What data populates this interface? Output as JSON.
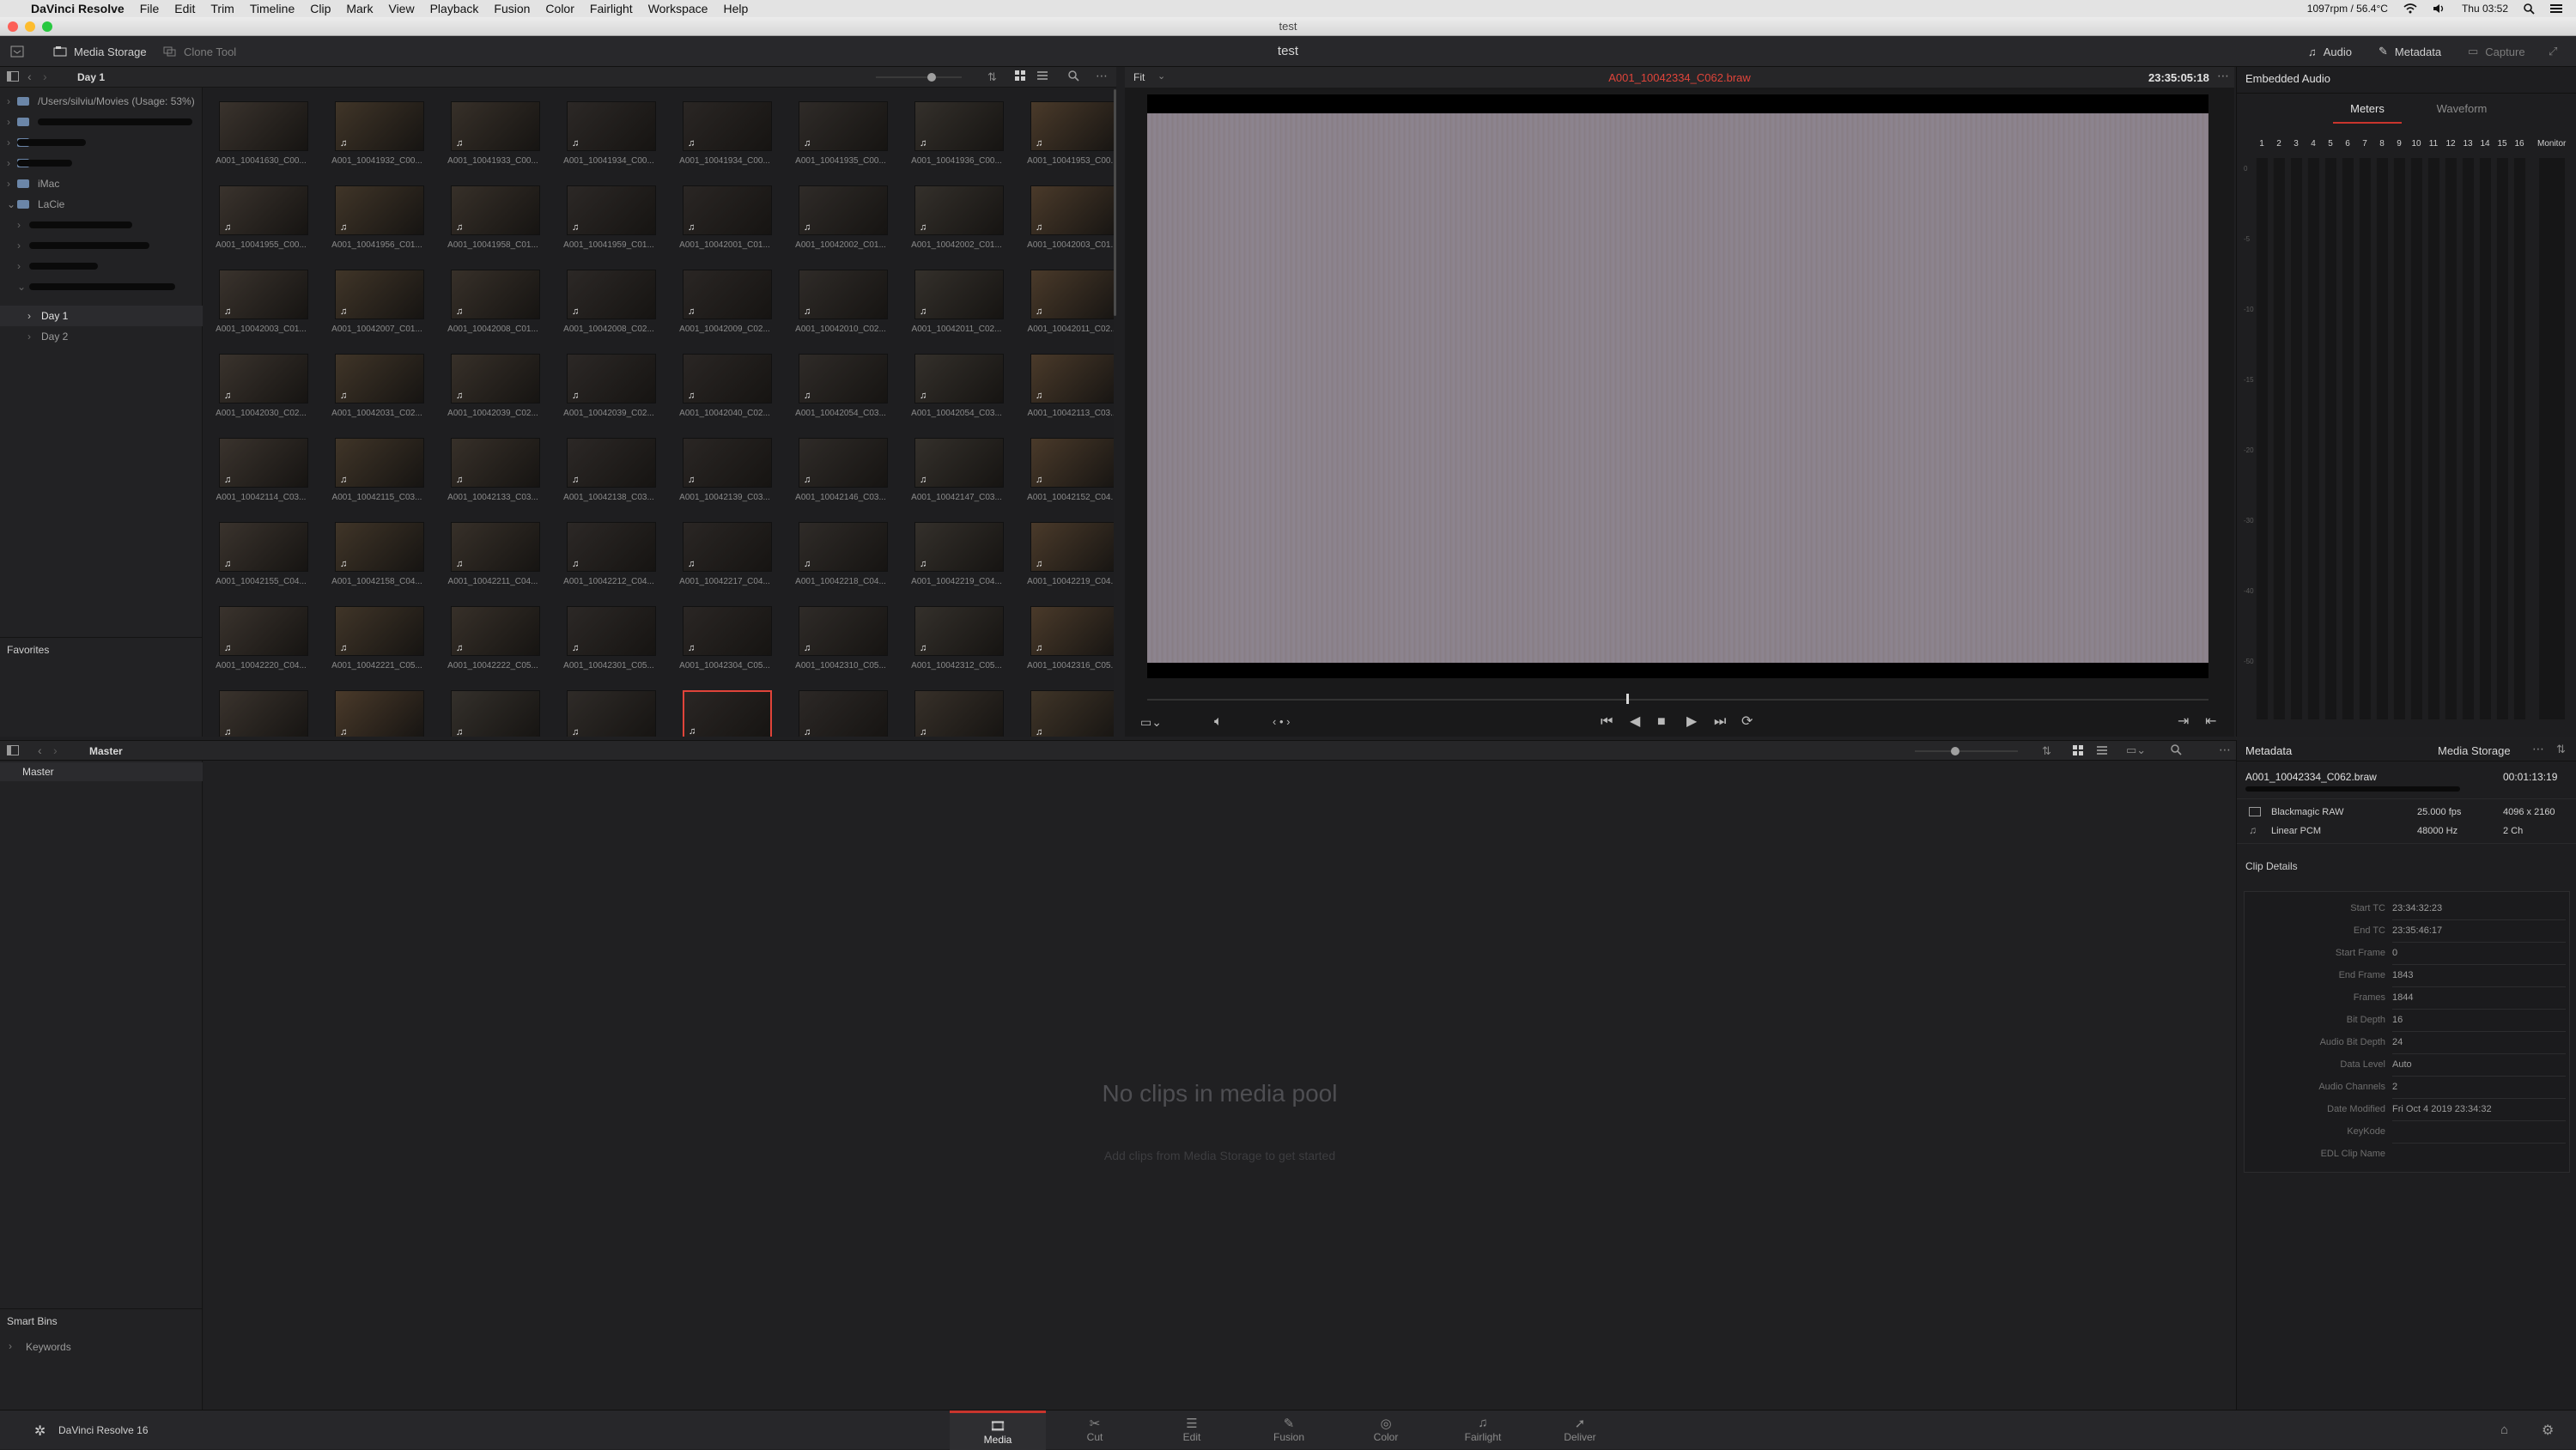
{
  "menubar": {
    "app": "DaVinci Resolve",
    "items": [
      "File",
      "Edit",
      "Trim",
      "Timeline",
      "Clip",
      "Mark",
      "View",
      "Playback",
      "Fusion",
      "Color",
      "Fairlight",
      "Workspace",
      "Help"
    ],
    "status": "1097rpm / 56.4°C",
    "clock": "Thu 03:52"
  },
  "window": {
    "title": "test"
  },
  "toolbar": {
    "media_storage": "Media Storage",
    "clone_tool": "Clone Tool",
    "project_title": "test",
    "audio": "Audio",
    "metadata": "Metadata",
    "capture": "Capture"
  },
  "media_storage": {
    "current_folder": "Day 1",
    "tree": [
      {
        "label": "/Users/silviu/Movies (Usage: 53%)"
      },
      {
        "label": "iMac"
      },
      {
        "label": "LaCie"
      },
      {
        "label": "Day 1"
      },
      {
        "label": "Day 2"
      }
    ],
    "favorites_label": "Favorites",
    "clips": [
      "A001_10041630_C00...",
      "A001_10041932_C00...",
      "A001_10041933_C00...",
      "A001_10041934_C00...",
      "A001_10041934_C00...",
      "A001_10041935_C00...",
      "A001_10041936_C00...",
      "A001_10041953_C00...",
      "A001_10041955_C00...",
      "A001_10041956_C01...",
      "A001_10041958_C01...",
      "A001_10041959_C01...",
      "A001_10042001_C01...",
      "A001_10042002_C01...",
      "A001_10042002_C01...",
      "A001_10042003_C01...",
      "A001_10042003_C01...",
      "A001_10042007_C01...",
      "A001_10042008_C01...",
      "A001_10042008_C02...",
      "A001_10042009_C02...",
      "A001_10042010_C02...",
      "A001_10042011_C02...",
      "A001_10042011_C02...",
      "A001_10042030_C02...",
      "A001_10042031_C02...",
      "A001_10042039_C02...",
      "A001_10042039_C02...",
      "A001_10042040_C02...",
      "A001_10042054_C03...",
      "A001_10042054_C03...",
      "A001_10042113_C03...",
      "A001_10042114_C03...",
      "A001_10042115_C03...",
      "A001_10042133_C03...",
      "A001_10042138_C03...",
      "A001_10042139_C03...",
      "A001_10042146_C03...",
      "A001_10042147_C03...",
      "A001_10042152_C04...",
      "A001_10042155_C04...",
      "A001_10042158_C04...",
      "A001_10042211_C04...",
      "A001_10042212_C04...",
      "A001_10042217_C04...",
      "A001_10042218_C04...",
      "A001_10042219_C04...",
      "A001_10042219_C04...",
      "A001_10042220_C04...",
      "A001_10042221_C05...",
      "A001_10042222_C05...",
      "A001_10042301_C05...",
      "A001_10042304_C05...",
      "A001_10042310_C05...",
      "A001_10042312_C05...",
      "A001_10042316_C05..."
    ]
  },
  "viewer": {
    "zoom": "Fit",
    "clip_name": "A001_10042334_C062.braw",
    "timecode": "23:35:05:18"
  },
  "audio_panel": {
    "title": "Embedded Audio",
    "tabs": [
      "Meters",
      "Waveform"
    ],
    "channels": [
      "1",
      "2",
      "3",
      "4",
      "5",
      "6",
      "7",
      "8",
      "9",
      "10",
      "11",
      "12",
      "13",
      "14",
      "15",
      "16"
    ],
    "monitor_label": "Monitor",
    "scale": [
      "0",
      "-5",
      "-10",
      "-15",
      "-20",
      "-30",
      "-40",
      "-50"
    ]
  },
  "media_pool": {
    "bin_title": "Master",
    "bins": [
      "Master"
    ],
    "empty_title": "No clips in media pool",
    "empty_hint": "Add clips from Media Storage to get started",
    "smart_bins_label": "Smart Bins",
    "smart_bins": [
      "Keywords"
    ]
  },
  "metadata": {
    "title": "Metadata",
    "source": "Media Storage",
    "clip_name": "A001_10042334_C062.braw",
    "duration": "00:01:13:19",
    "video_codec": "Blackmagic RAW",
    "fps": "25.000 fps",
    "resolution": "4096 x 2160",
    "audio_codec": "Linear PCM",
    "sample_rate": "48000 Hz",
    "audio_ch": "2 Ch",
    "clip_details_label": "Clip Details",
    "details": [
      {
        "key": "Start TC",
        "value": "23:34:32:23"
      },
      {
        "key": "End TC",
        "value": "23:35:46:17"
      },
      {
        "key": "Start Frame",
        "value": "0"
      },
      {
        "key": "End Frame",
        "value": "1843"
      },
      {
        "key": "Frames",
        "value": "1844"
      },
      {
        "key": "Bit Depth",
        "value": "16"
      },
      {
        "key": "Audio Bit Depth",
        "value": "24"
      },
      {
        "key": "Data Level",
        "value": "Auto"
      },
      {
        "key": "Audio Channels",
        "value": "2"
      },
      {
        "key": "Date Modified",
        "value": "Fri Oct 4 2019 23:34:32"
      },
      {
        "key": "KeyKode",
        "value": ""
      },
      {
        "key": "EDL Clip Name",
        "value": ""
      }
    ]
  },
  "pages": {
    "brand": "DaVinci Resolve 16",
    "tabs": [
      "Media",
      "Cut",
      "Edit",
      "Fusion",
      "Color",
      "Fairlight",
      "Deliver"
    ]
  }
}
